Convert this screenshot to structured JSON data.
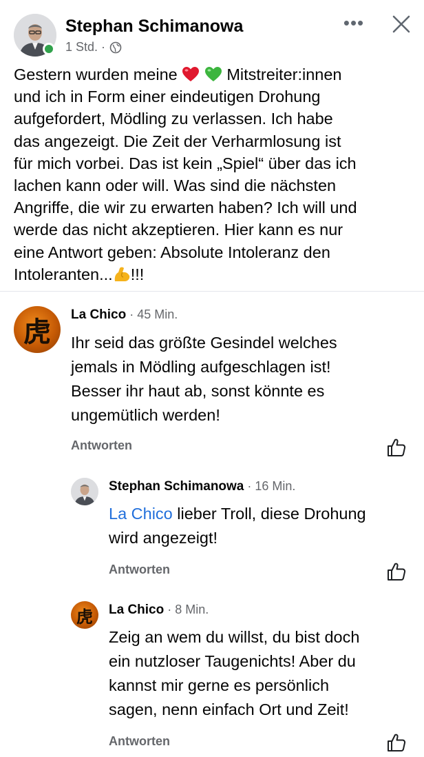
{
  "post": {
    "author": "Stephan Schimanowa",
    "time": "1 Std. ·",
    "text_1": "Gestern wurden meine ",
    "text_2": " Mitstreiter:innen\nund ich in Form einer eindeutigen Drohung\naufgefordert, Mödling zu verlassen. Ich habe\ndas angezeigt. Die Zeit der Verharmlosung ist\nfür mich vorbei. Das ist kein „Spiel“ über das ich\nlachen kann oder will. Was sind die nächsten\nAngriffe, die wir zu erwarten haben? Ich will und\nwerde das nicht akzeptieren. Hier kann es nur\neine Antwort geben: Absolute Intoleranz den\nIntoleranten...",
    "text_3": "!!!",
    "more_label": "•••"
  },
  "comments": [
    {
      "name": "La Chico",
      "time": " · 45 Min.",
      "text": "Ihr seid das größte Gesindel welches\njemals in Mödling aufgeschlagen ist!\nBesser ihr haut ab, sonst könnte es\nungemütlich werden!",
      "reply_label": "Antworten",
      "avatar_glyph": "虎"
    },
    {
      "name": "Stephan Schimanowa",
      "time": " · 16 Min.",
      "mention": "La Chico",
      "text": " lieber Troll, diese Drohung\nwird angezeigt!",
      "reply_label": "Antworten"
    },
    {
      "name": "La Chico",
      "time": " · 8 Min.",
      "text": "Zeig an wem du willst, du bist doch\nein nutzloser Taugenichts! Aber du\nkannst mir gerne es persönlich\nsagen, nenn einfach Ort und Zeit!",
      "reply_label": "Antworten",
      "avatar_glyph": "虎"
    }
  ],
  "colors": {
    "online": "#31a24c",
    "mention": "#216fdb",
    "secondary_text": "#65676b"
  },
  "icons": [
    "globe-icon",
    "more-icon",
    "close-icon",
    "heart-red-emoji",
    "heart-green-emoji",
    "flexed-biceps-emoji",
    "like-icon"
  ]
}
